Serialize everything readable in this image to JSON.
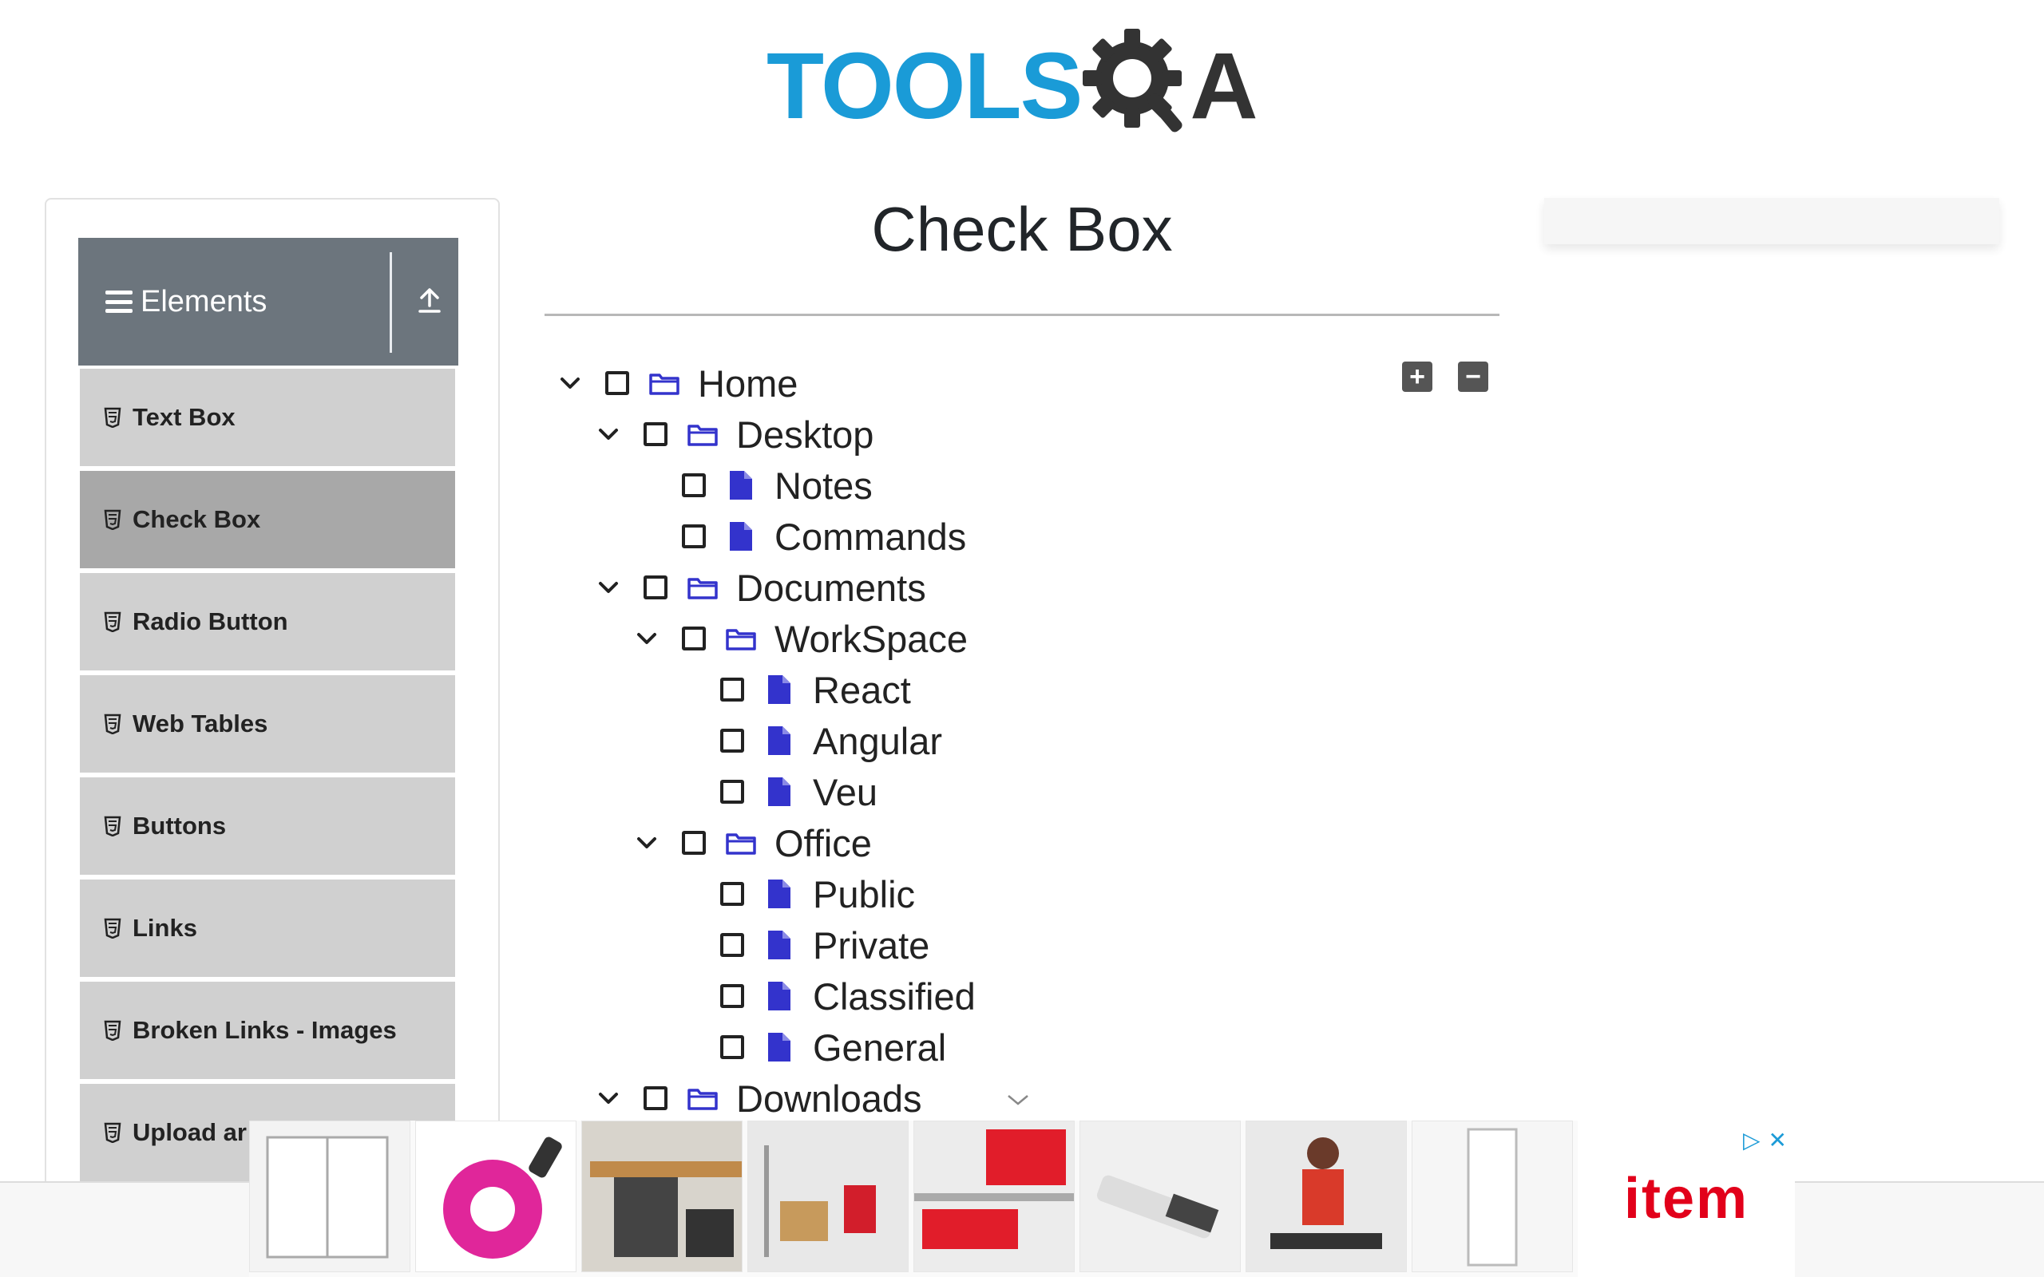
{
  "header": {
    "logo_text_left": "TOOLS",
    "logo_text_right": "A",
    "logo_alt": "ToolsQA logo"
  },
  "sidebar": {
    "group_title": "Elements",
    "items": [
      {
        "label": "Text Box",
        "active": false
      },
      {
        "label": "Check Box",
        "active": true
      },
      {
        "label": "Radio Button",
        "active": false
      },
      {
        "label": "Web Tables",
        "active": false
      },
      {
        "label": "Buttons",
        "active": false
      },
      {
        "label": "Links",
        "active": false
      },
      {
        "label": "Broken Links - Images",
        "active": false
      },
      {
        "label": "Upload ar",
        "active": false
      }
    ]
  },
  "main": {
    "title": "Check Box",
    "expand_all_label": "+",
    "collapse_all_label": "−",
    "tree": [
      {
        "label": "Home",
        "type": "folder",
        "depth": 0,
        "expanded": true
      },
      {
        "label": "Desktop",
        "type": "folder",
        "depth": 1,
        "expanded": true
      },
      {
        "label": "Notes",
        "type": "file",
        "depth": 2
      },
      {
        "label": "Commands",
        "type": "file",
        "depth": 2
      },
      {
        "label": "Documents",
        "type": "folder",
        "depth": 1,
        "expanded": true
      },
      {
        "label": "WorkSpace",
        "type": "folder",
        "depth": 2,
        "expanded": true
      },
      {
        "label": "React",
        "type": "file",
        "depth": 3
      },
      {
        "label": "Angular",
        "type": "file",
        "depth": 3
      },
      {
        "label": "Veu",
        "type": "file",
        "depth": 3
      },
      {
        "label": "Office",
        "type": "folder",
        "depth": 2,
        "expanded": true
      },
      {
        "label": "Public",
        "type": "file",
        "depth": 3
      },
      {
        "label": "Private",
        "type": "file",
        "depth": 3
      },
      {
        "label": "Classified",
        "type": "file",
        "depth": 3
      },
      {
        "label": "General",
        "type": "file",
        "depth": 3
      },
      {
        "label": "Downloads",
        "type": "folder",
        "depth": 1,
        "expanded": true
      }
    ]
  },
  "ad": {
    "brand": "item",
    "close_symbol": "✕",
    "adchoices_symbol": "▷"
  },
  "colors": {
    "logo_blue": "#1a9bd7",
    "sidebar_header": "#6c757d",
    "menu_item_bg": "#d0d0d0",
    "menu_item_active_bg": "#a8a8a8",
    "tree_icon": "#3333cc",
    "ad_brand": "#e2001a"
  }
}
